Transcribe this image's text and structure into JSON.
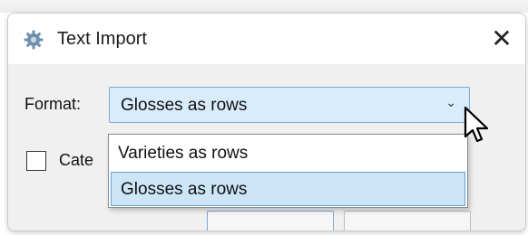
{
  "window": {
    "title": "Text Import",
    "icon": "gear-icon",
    "close_glyph": "✕"
  },
  "form": {
    "format_label": "Format:",
    "format_selected": "Glosses as rows",
    "checkbox_label": "Cate",
    "checkbox_checked": false
  },
  "dropdown": {
    "options": [
      {
        "label": "Varieties as rows",
        "selected": false
      },
      {
        "label": "Glosses as rows",
        "selected": true
      }
    ]
  },
  "colors": {
    "accent": "#5fa2d9",
    "selection": "#cde6f7",
    "combo_bg": "#d9ecfb"
  }
}
